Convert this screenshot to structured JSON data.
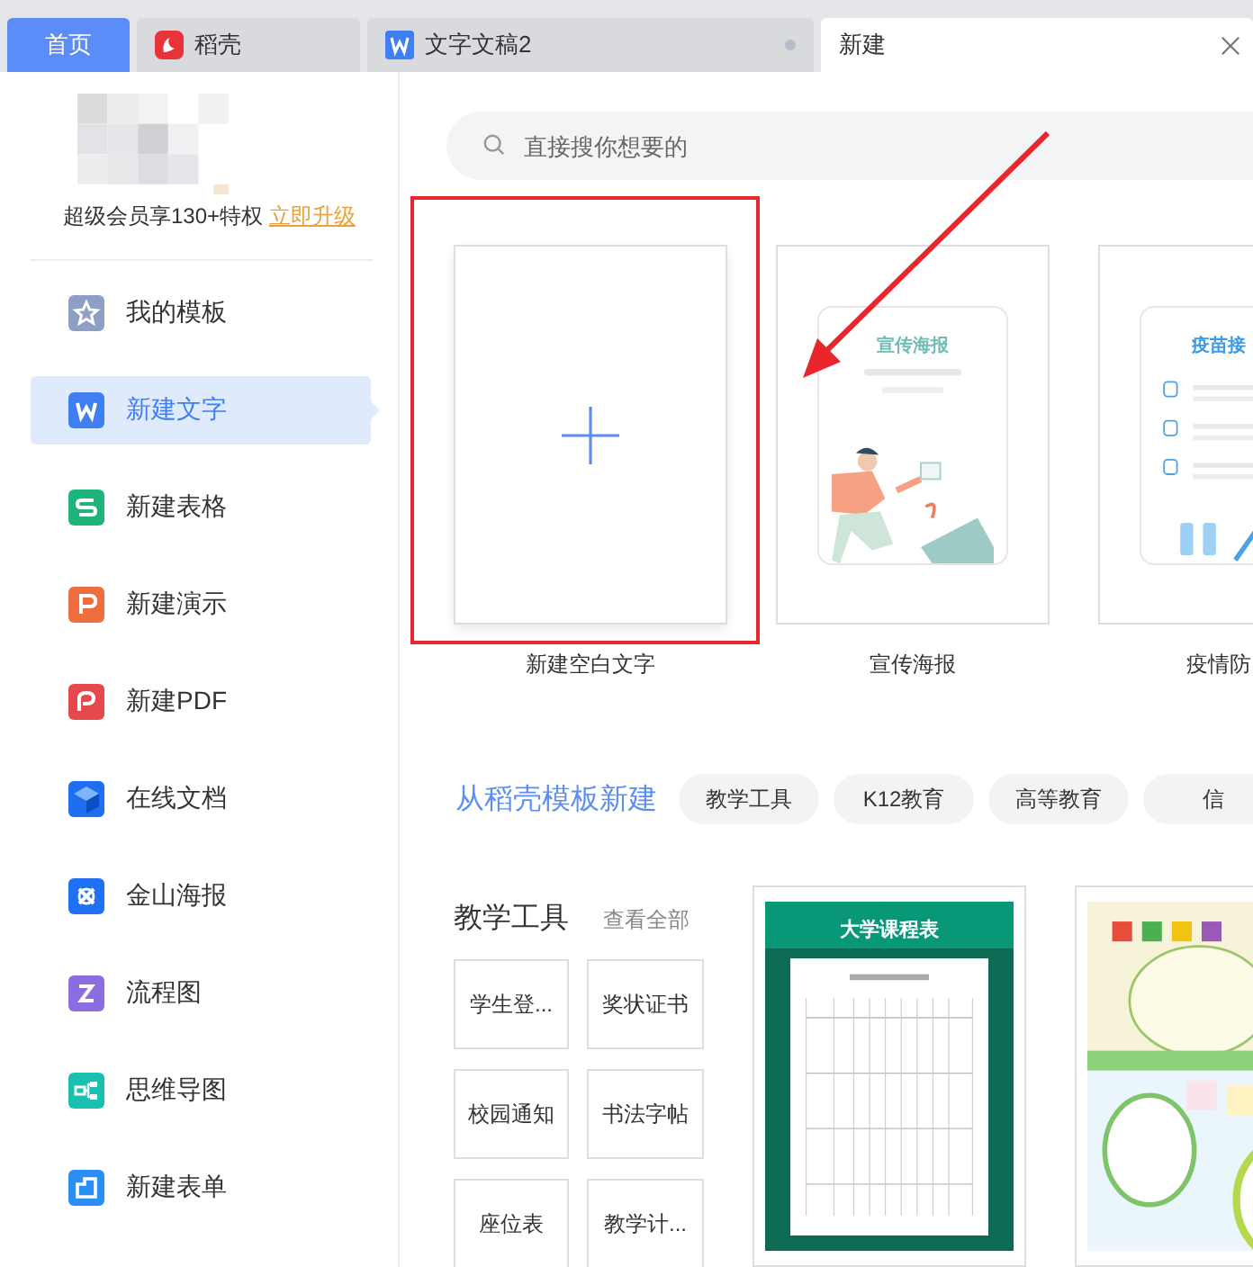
{
  "tabs": [
    {
      "label": "首页",
      "kind": "home",
      "selected": false
    },
    {
      "label": "稻壳",
      "kind": "docer",
      "selected": false
    },
    {
      "label": "文字文稿2",
      "kind": "doc",
      "selected": false,
      "unsaved": true
    },
    {
      "label": "新建",
      "kind": "plain",
      "selected": true,
      "closable": true
    }
  ],
  "sidebar": {
    "promo": {
      "text": "超级会员享130+特权",
      "link": "立即升级"
    },
    "items": [
      {
        "label": "我的模板",
        "color": "#8e9fc4",
        "selected": false
      },
      {
        "label": "新建文字",
        "color": "#3f7ff2",
        "selected": true
      },
      {
        "label": "新建表格",
        "color": "#1fb57a",
        "selected": false
      },
      {
        "label": "新建演示",
        "color": "#ee6f3d",
        "selected": false
      },
      {
        "label": "新建PDF",
        "color": "#e5484d",
        "selected": false
      },
      {
        "label": "在线文档",
        "color": "#1d6ff0",
        "selected": false
      },
      {
        "label": "金山海报",
        "color": "#1f70f5",
        "selected": false
      },
      {
        "label": "流程图",
        "color": "#8a6de0",
        "selected": false
      },
      {
        "label": "思维导图",
        "color": "#19c0b0",
        "selected": false
      },
      {
        "label": "新建表单",
        "color": "#2a8ff5",
        "selected": false
      }
    ]
  },
  "search": {
    "placeholder": "直接搜你想要的"
  },
  "new_cards": [
    {
      "kind": "blank",
      "label": "新建空白文字"
    },
    {
      "kind": "poster",
      "title": "宣传海报",
      "label": "宣传海报"
    },
    {
      "kind": "checklist",
      "title": "疫苗接",
      "label": "疫情防"
    }
  ],
  "template_section": {
    "heading": "从稻壳模板新建",
    "chips": [
      "教学工具",
      "K12教育",
      "高等教育",
      "信"
    ]
  },
  "category": {
    "title": "教学工具",
    "view_all": "查看全部",
    "items": [
      "学生登...",
      "奖状证书",
      "校园通知",
      "书法字帖",
      "座位表",
      "教学计..."
    ]
  },
  "templates": [
    {
      "kind": "schedule",
      "title": "大学课程表"
    },
    {
      "kind": "picture"
    }
  ]
}
